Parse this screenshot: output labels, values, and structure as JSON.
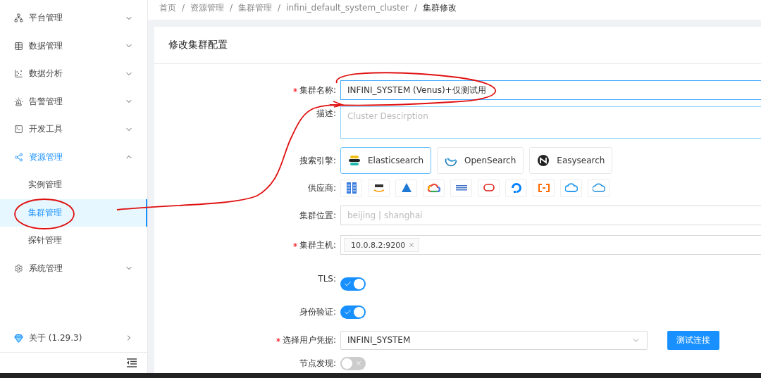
{
  "sidebar": {
    "items": [
      {
        "label": "平台管理",
        "expanded": false,
        "selected": false
      },
      {
        "label": "数据管理",
        "expanded": false,
        "selected": false
      },
      {
        "label": "数据分析",
        "expanded": false,
        "selected": false
      },
      {
        "label": "告警管理",
        "expanded": false,
        "selected": false
      },
      {
        "label": "开发工具",
        "expanded": false,
        "selected": false
      },
      {
        "label": "资源管理",
        "expanded": true,
        "selected": true,
        "children": [
          {
            "label": "实例管理",
            "selected": false
          },
          {
            "label": "集群管理",
            "selected": true
          },
          {
            "label": "探针管理",
            "selected": false
          }
        ]
      },
      {
        "label": "系统管理",
        "expanded": false,
        "selected": false
      }
    ],
    "about": {
      "label": "关于 (1.29.3)"
    }
  },
  "breadcrumb": {
    "separator": "/",
    "items": [
      "首页",
      "资源管理",
      "集群管理",
      "infini_default_system_cluster",
      "集群修改"
    ]
  },
  "card": {
    "title": "修改集群配置"
  },
  "form": {
    "name": {
      "label": "集群名称:",
      "required": true,
      "value": "INFINI_SYSTEM (Venus)+仅测试用"
    },
    "description": {
      "label": "描述:",
      "placeholder": "Cluster Descirption"
    },
    "engine": {
      "label": "搜索引擎:",
      "options": [
        {
          "label": "Elasticsearch",
          "selected": true
        },
        {
          "label": "OpenSearch",
          "selected": false
        },
        {
          "label": "Easysearch",
          "selected": false
        }
      ]
    },
    "provider": {
      "label": "供应商:"
    },
    "location": {
      "label": "集群位置:",
      "placeholder": "beijing | shanghai"
    },
    "hosts": {
      "label": "集群主机:",
      "required": true,
      "tags": [
        "10.0.8.2:9200"
      ]
    },
    "tls": {
      "label": "TLS:",
      "on": true
    },
    "auth": {
      "label": "身份验证:",
      "on": true
    },
    "credential": {
      "label": "选择用户凭据:",
      "required": true,
      "value": "INFINI_SYSTEM",
      "button": "测试连接"
    },
    "discovery": {
      "label": "节点发现:",
      "on": false
    }
  }
}
